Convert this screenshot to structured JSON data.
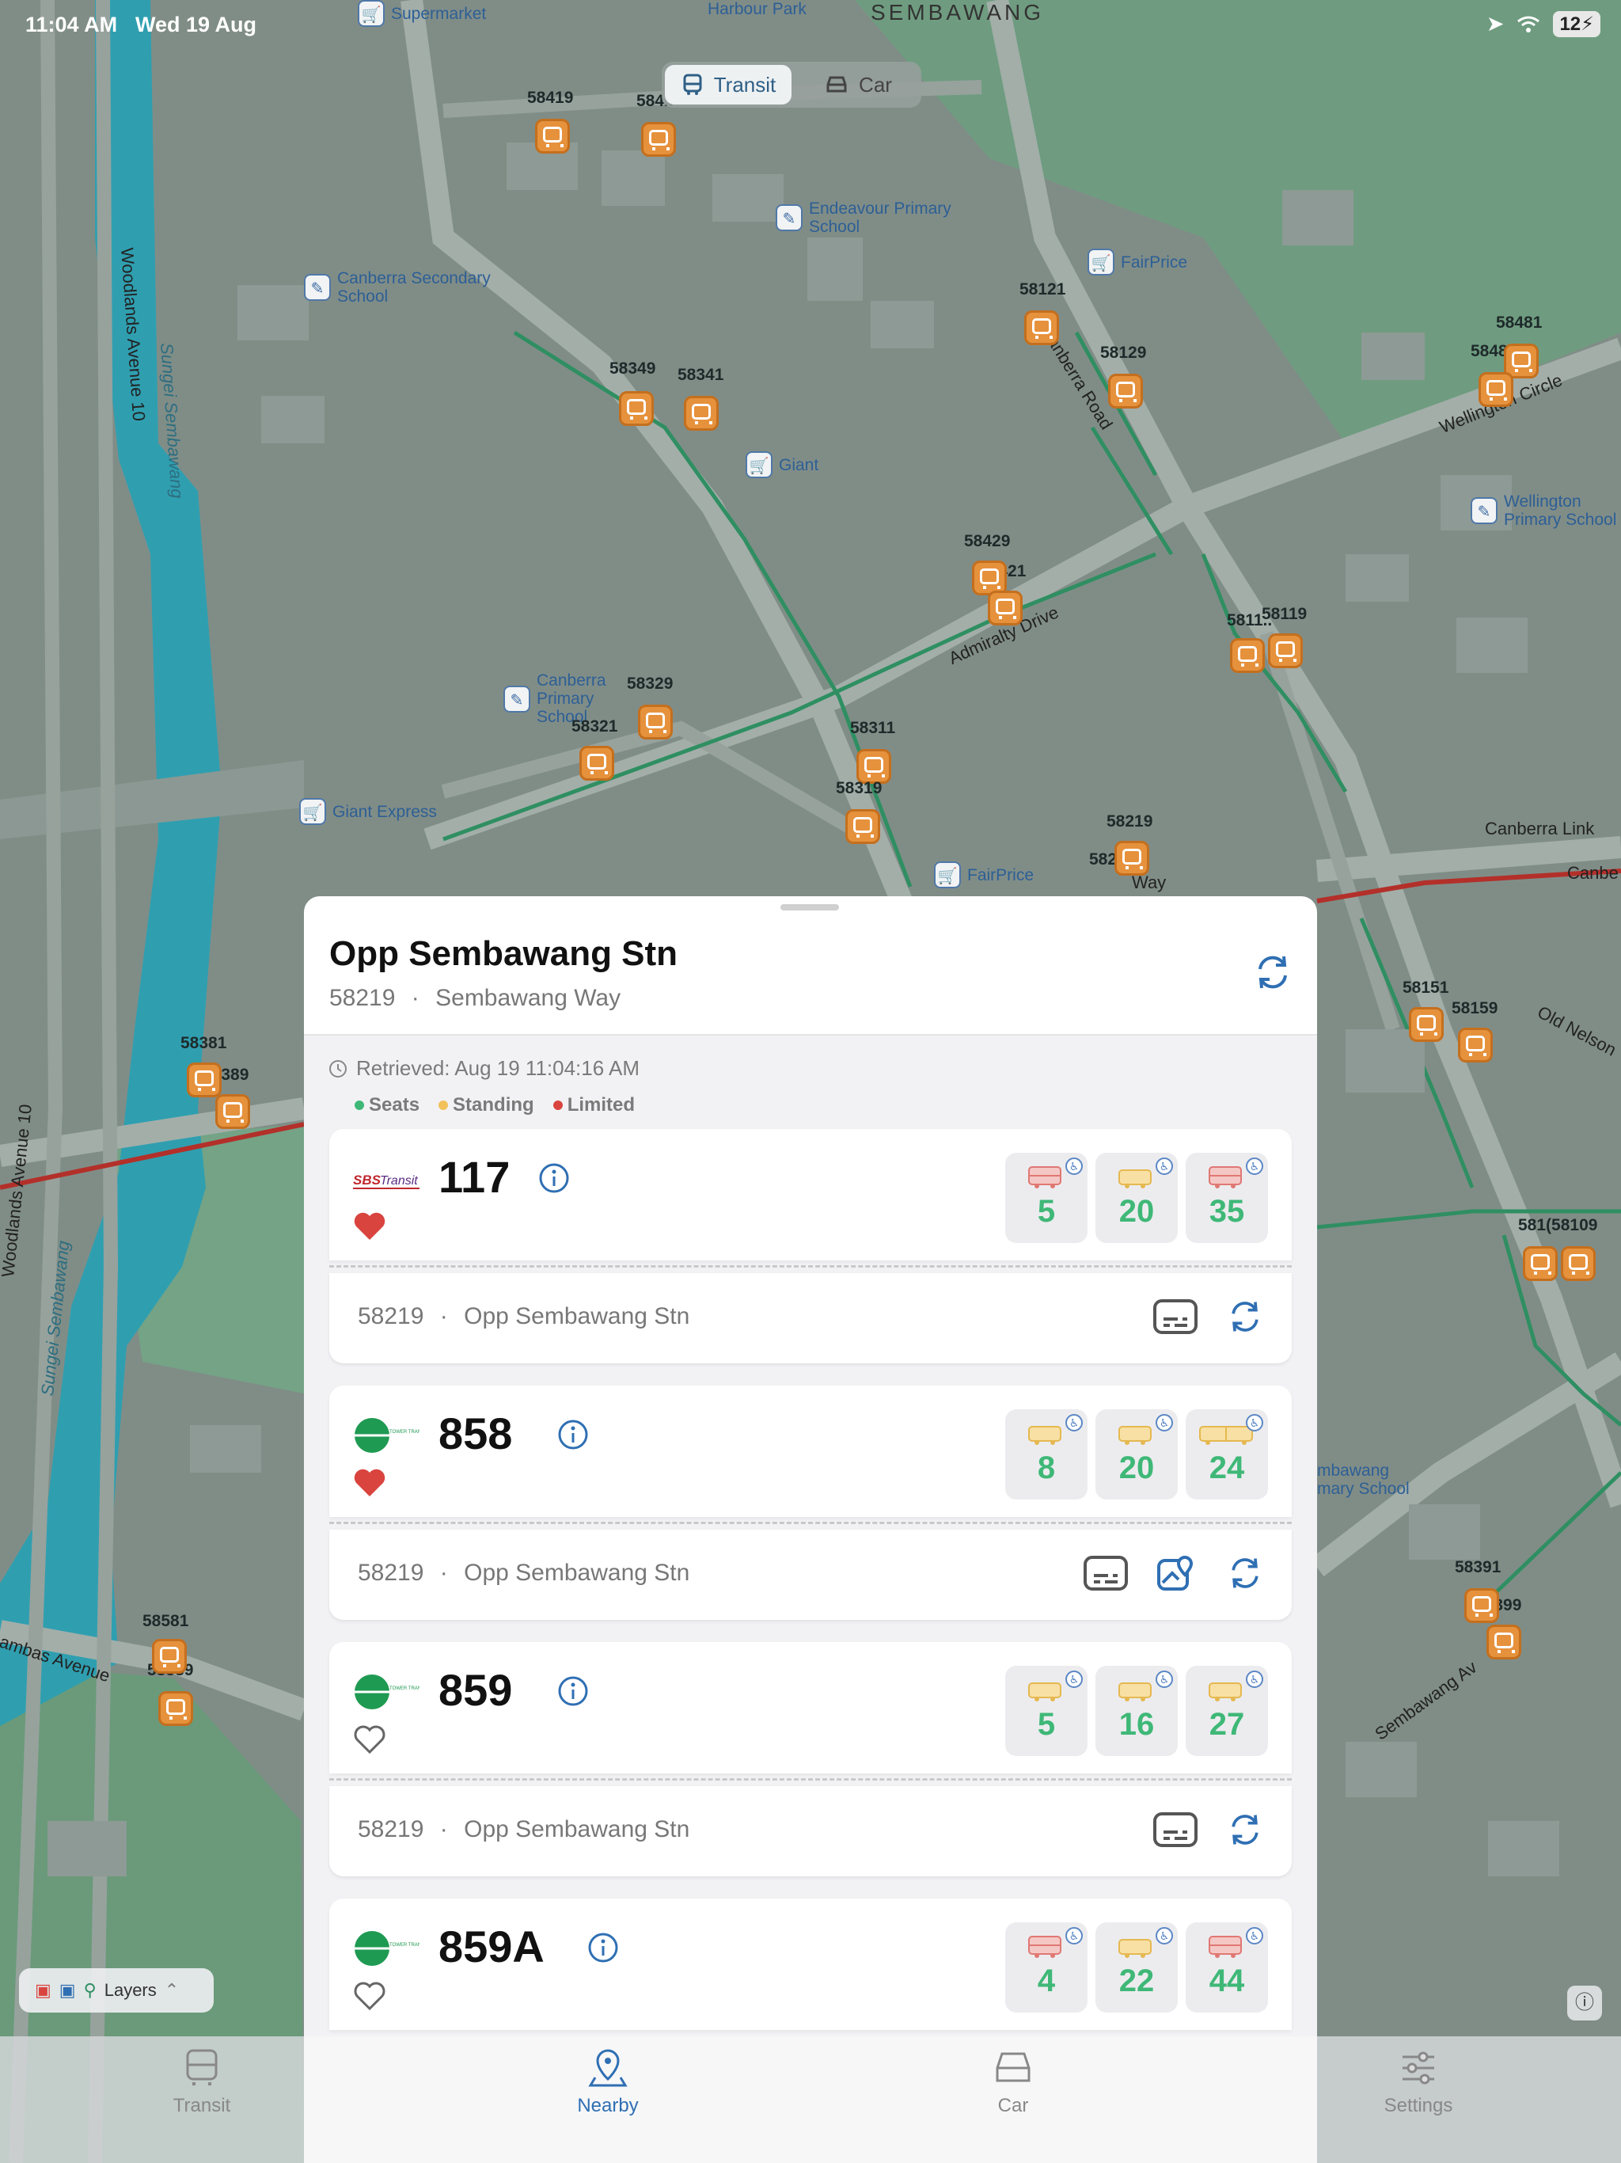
{
  "status_bar": {
    "time": "11:04 AM",
    "date": "Wed 19 Aug",
    "battery": "12"
  },
  "mode_toggle": {
    "transit": "Transit",
    "car": "Car"
  },
  "map": {
    "stop_codes": [
      "58419",
      "584..",
      "58121",
      "58129",
      "58349",
      "58341",
      "58481",
      "58489",
      "58429",
      "58421",
      "58119",
      "5811..",
      "58329",
      "58321",
      "58311",
      "58319",
      "58219",
      "58211",
      "58381",
      "58389",
      "58151",
      "58159",
      "58581",
      "58589",
      "58391",
      "58399",
      "581(58109"
    ],
    "poi": {
      "supermarket": "Supermarket",
      "harbour_park": "Harbour Park",
      "endeavour": "Endeavour Primary School",
      "canberra_sec": "Canberra Secondary School",
      "fairprice1": "FairPrice",
      "giant": "Giant",
      "wellington": "Wellington Primary School",
      "canberra_pri": "Canberra Primary School",
      "giant_express": "Giant Express",
      "fairprice2": "FairPrice",
      "sembawang_school": "mbawang mary School"
    },
    "streets": {
      "woodlands10": "Woodlands Avenue 10",
      "woodlands10b": "Woodlands Avenue 10",
      "sungei": "Sungei Sembawang",
      "sungei_b": "Sungei Sembawang",
      "wellington_circle": "Wellington Circle",
      "admiralty": "Admiralty Drive",
      "canberra_road": "Canberra Road",
      "canberra_link": "Canberra Link",
      "sembawang_way": "Way",
      "old_nelson": "Old Nelson",
      "sembawang_ave": "Sembawang Av",
      "sembawang_top": "SEMBAWANG",
      "canbe": "Canbe",
      "mbas": "ambas Avenue"
    }
  },
  "panel": {
    "stop_name": "Opp Sembawang Stn",
    "stop_code": "58219",
    "road": "Sembawang Way",
    "retrieved": "Retrieved: Aug 19 11:04:16 AM",
    "legend": {
      "seats": "Seats",
      "standing": "Standing",
      "limited": "Limited"
    },
    "colors": {
      "seats": "#3fb877",
      "standing": "#f2c15a",
      "limited": "#d9443f",
      "accent": "#2f6fb3"
    },
    "services": [
      {
        "number": "117",
        "operator": "SBS Transit",
        "favorite": true,
        "arrivals": [
          "5",
          "20",
          "35"
        ],
        "stop_code": "58219",
        "stop_name": "Opp Sembawang Stn"
      },
      {
        "number": "858",
        "operator": "Tower Transit",
        "favorite": true,
        "arrivals": [
          "8",
          "20",
          "24"
        ],
        "stop_code": "58219",
        "stop_name": "Opp Sembawang Stn"
      },
      {
        "number": "859",
        "operator": "Tower Transit",
        "favorite": false,
        "arrivals": [
          "5",
          "16",
          "27"
        ],
        "stop_code": "58219",
        "stop_name": "Opp Sembawang Stn"
      },
      {
        "number": "859A",
        "operator": "Tower Transit",
        "favorite": false,
        "arrivals": [
          "4",
          "22",
          "44"
        ]
      }
    ]
  },
  "layers_label": "Layers",
  "tabs": {
    "transit": "Transit",
    "nearby": "Nearby",
    "car": "Car",
    "settings": "Settings"
  }
}
